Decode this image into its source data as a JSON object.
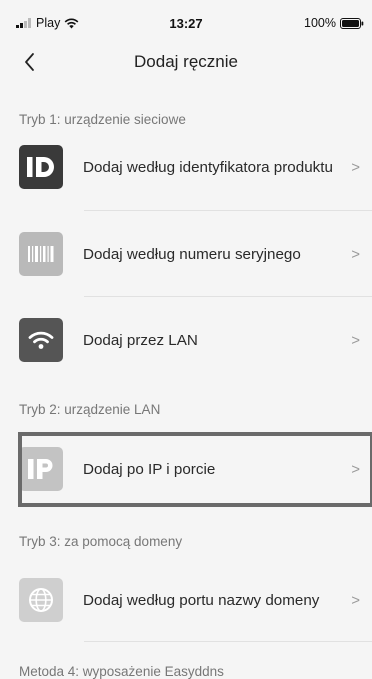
{
  "status_bar": {
    "carrier": "Play",
    "time": "13:27",
    "battery": "100%"
  },
  "nav": {
    "title": "Dodaj ręcznie",
    "back_icon": "chevron-left-icon"
  },
  "sections": [
    {
      "label": "Tryb 1: urządzenie sieciowe"
    },
    {
      "label": "Tryb 2: urządzenie LAN"
    },
    {
      "label": "Tryb 3: za pomocą domeny"
    },
    {
      "label": "Metoda 4: wyposażenie Easyddns"
    }
  ],
  "items": [
    {
      "label": "Dodaj według identyfikatora produktu",
      "icon": "id-icon",
      "icon_text": "ID",
      "icon_color": "#3a3a3a"
    },
    {
      "label": "Dodaj według numeru seryjnego",
      "icon": "barcode-icon",
      "icon_color": "#b9b9b9"
    },
    {
      "label": "Dodaj przez LAN",
      "icon": "wifi-icon",
      "icon_color": "#555555"
    },
    {
      "label": "Dodaj po IP i porcie",
      "icon": "ip-icon",
      "icon_text": "IP",
      "icon_color": "#c3c3c3"
    },
    {
      "label": "Dodaj według portu nazwy domeny",
      "icon": "globe-icon",
      "icon_color": "#cfcfcf"
    }
  ],
  "chevron": ">"
}
